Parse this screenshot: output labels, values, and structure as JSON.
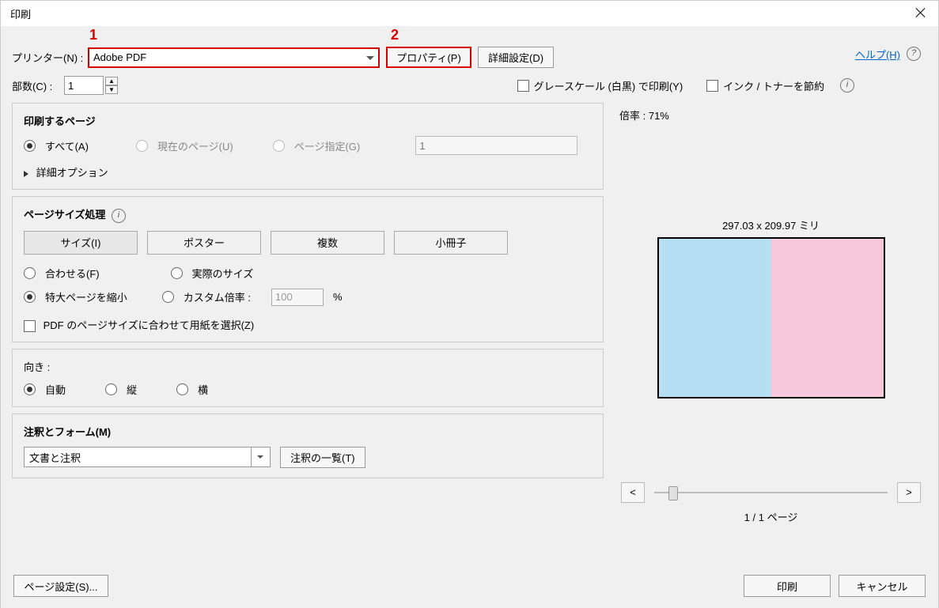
{
  "title": "印刷",
  "callouts": {
    "c1": "1",
    "c2": "2"
  },
  "printer": {
    "label": "プリンター(N) :",
    "value": "Adobe PDF",
    "properties_btn": "プロパティ(P)",
    "advanced_btn": "詳細設定(D)"
  },
  "help_link": "ヘルプ(H)",
  "copies": {
    "label": "部数(C) :",
    "value": "1"
  },
  "grayscale_label": "グレースケール (白黒) で印刷(Y)",
  "save_ink_label": "インク / トナーを節約",
  "pages_panel": {
    "title": "印刷するページ",
    "all_label": "すべて(A)",
    "current_label": "現在のページ(U)",
    "range_label": "ページ指定(G)",
    "range_placeholder": "1",
    "expand_label": "詳細オプション"
  },
  "size_panel": {
    "title": "ページサイズ処理",
    "size_btn": "サイズ(I)",
    "poster_btn": "ポスター",
    "multi_btn": "複数",
    "booklet_btn": "小冊子",
    "fit_label": "合わせる(F)",
    "actual_label": "実際のサイズ",
    "shrink_label": "特大ページを縮小",
    "custom_label": "カスタム倍率 :",
    "custom_value": "100",
    "pct": "%",
    "pdf_size_label": "PDF のページサイズに合わせて用紙を選択(Z)"
  },
  "orient_panel": {
    "title": "向き :",
    "auto_label": "自動",
    "portrait_label": "縦",
    "landscape_label": "横"
  },
  "anno_panel": {
    "title": "注釈とフォーム(M)",
    "combo_value": "文書と注釈",
    "list_btn": "注釈の一覧(T)"
  },
  "preview": {
    "scale_label": "倍率 : 71%",
    "dimensions": "297.03 x 209.97 ミリ",
    "prev": "<",
    "next": ">",
    "page_indicator": "1 / 1 ページ"
  },
  "footer": {
    "page_setup": "ページ設定(S)...",
    "print_btn": "印刷",
    "cancel_btn": "キャンセル"
  }
}
